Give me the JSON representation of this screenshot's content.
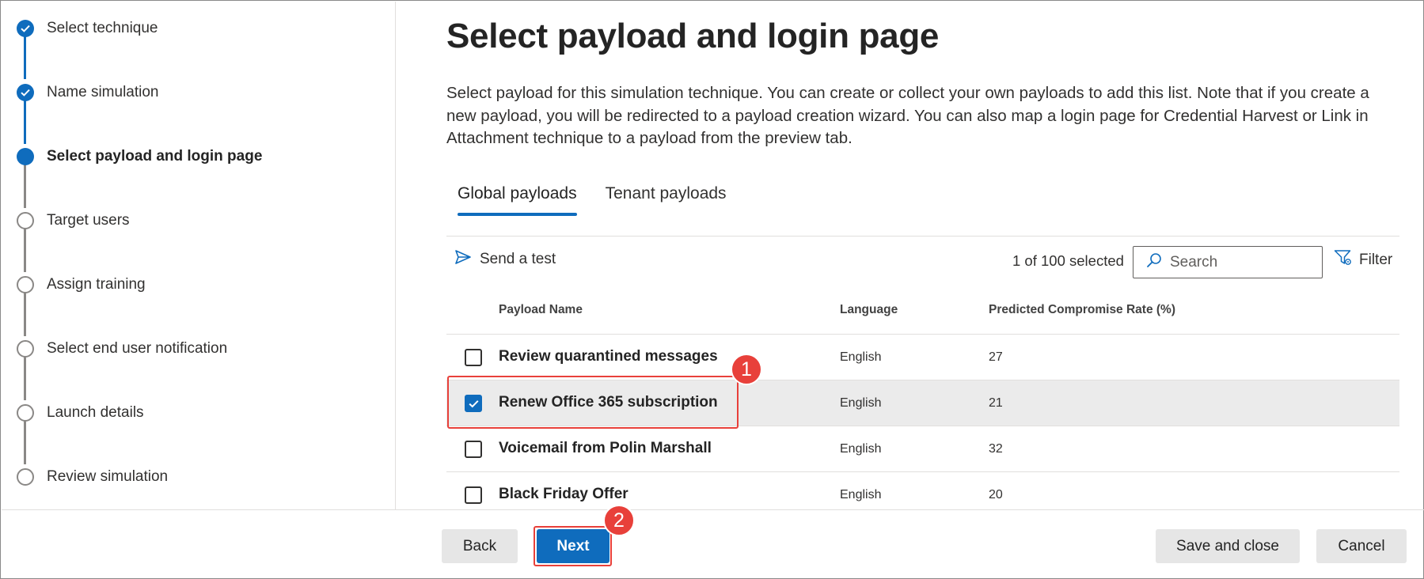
{
  "wizard": {
    "steps": [
      {
        "label": "Select technique",
        "state": "done"
      },
      {
        "label": "Name simulation",
        "state": "done"
      },
      {
        "label": "Select payload and login page",
        "state": "current"
      },
      {
        "label": "Target users",
        "state": "todo"
      },
      {
        "label": "Assign training",
        "state": "todo"
      },
      {
        "label": "Select end user notification",
        "state": "todo"
      },
      {
        "label": "Launch details",
        "state": "todo"
      },
      {
        "label": "Review simulation",
        "state": "todo"
      }
    ]
  },
  "main": {
    "title": "Select payload and login page",
    "description": "Select payload for this simulation technique. You can create or collect your own payloads to add this list. Note that if you create a new payload, you will be redirected to a payload creation wizard. You can also map a login page for Credential Harvest or Link in Attachment technique to a payload from the preview tab.",
    "tabs": [
      {
        "label": "Global payloads",
        "active": true
      },
      {
        "label": "Tenant payloads",
        "active": false
      }
    ]
  },
  "toolbar": {
    "send_test_label": "Send a test",
    "send_test_icon": "send-icon",
    "selected_count": "1 of 100 selected",
    "search_placeholder": "Search",
    "search_icon": "search-icon",
    "filter_label": "Filter",
    "filter_icon": "filter-icon"
  },
  "table": {
    "columns": [
      "Payload Name",
      "Language",
      "Predicted Compromise Rate (%)"
    ],
    "rows": [
      {
        "name": "Review quarantined messages",
        "language": "English",
        "rate": "27",
        "checked": false
      },
      {
        "name": "Renew Office 365 subscription",
        "language": "English",
        "rate": "21",
        "checked": true
      },
      {
        "name": "Voicemail from Polin Marshall",
        "language": "English",
        "rate": "32",
        "checked": false
      },
      {
        "name": "Black Friday Offer",
        "language": "English",
        "rate": "20",
        "checked": false
      }
    ]
  },
  "footer": {
    "back_label": "Back",
    "next_label": "Next",
    "save_close_label": "Save and close",
    "cancel_label": "Cancel"
  },
  "annotations": {
    "badge_1": "1",
    "badge_2": "2"
  },
  "colors": {
    "accent": "#0f6cbd",
    "callout": "#e8403a",
    "selected_row": "#ebebeb"
  }
}
